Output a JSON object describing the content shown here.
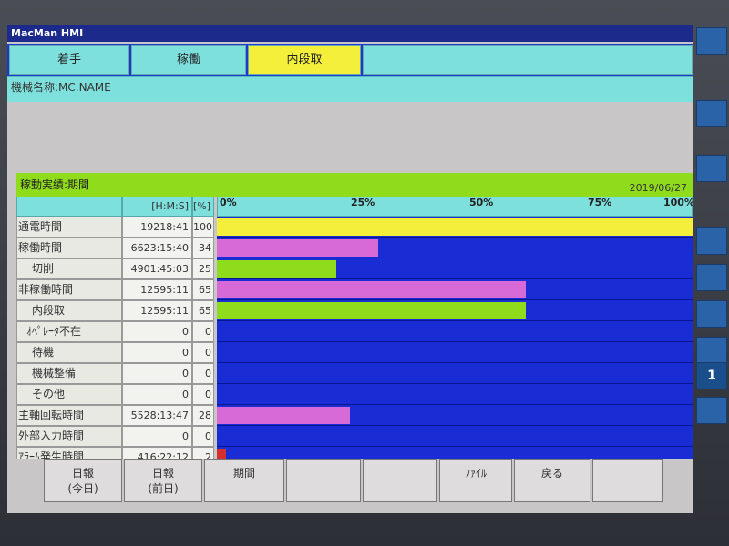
{
  "window": {
    "title": "MacMan HMI"
  },
  "tabs": [
    {
      "label": "着手",
      "active": false
    },
    {
      "label": "稼働",
      "active": false
    },
    {
      "label": "内段取",
      "active": true
    }
  ],
  "machine": {
    "label": "機械名称:MC.NAME"
  },
  "section": {
    "title": "稼動実績:期間",
    "date": "2019/06/27"
  },
  "columns": {
    "time": "[H:M:S]",
    "pct": "[%]"
  },
  "scale": {
    "p0": "0%",
    "p25": "25%",
    "p50": "50%",
    "p75": "75%",
    "p100": "100%"
  },
  "rows": [
    {
      "name": "通電時間",
      "time": "19218:41",
      "pct": "100",
      "color": "#f3ef3a"
    },
    {
      "name": "稼働時間",
      "time": "6623:15:40",
      "pct": "34",
      "color": "#d86ad8"
    },
    {
      "name": "切削",
      "time": "4901:45:03",
      "pct": "25",
      "color": "#8fdc1d"
    },
    {
      "name": "非稼働時間",
      "time": "12595:11",
      "pct": "65",
      "color": "#d86ad8"
    },
    {
      "name": "内段取",
      "time": "12595:11",
      "pct": "65",
      "color": "#8fdc1d"
    },
    {
      "name": "ｵﾍﾟﾚｰﾀ不在",
      "time": "0",
      "pct": "0",
      "color": "#8fdc1d"
    },
    {
      "name": "待機",
      "time": "0",
      "pct": "0",
      "color": "#8fdc1d"
    },
    {
      "name": "機械整備",
      "time": "0",
      "pct": "0",
      "color": "#8fdc1d"
    },
    {
      "name": "その他",
      "time": "0",
      "pct": "0",
      "color": "#8fdc1d"
    },
    {
      "name": "主軸回転時間",
      "time": "5528:13:47",
      "pct": "28",
      "color": "#d86ad8"
    },
    {
      "name": "外部入力時間",
      "time": "0",
      "pct": "0",
      "color": "#d86ad8"
    },
    {
      "name": "ｱﾗｰﾑ発生時間",
      "time": "416:22:12",
      "pct": "2",
      "color": "#d43030"
    }
  ],
  "softkeys": [
    {
      "line1": "日報",
      "line2": "(今日)"
    },
    {
      "line1": "日報",
      "line2": "(前日)"
    },
    {
      "line1": "期間",
      "line2": ""
    },
    {
      "line1": "",
      "line2": ""
    },
    {
      "line1": "",
      "line2": ""
    },
    {
      "line1": "ﾌｧｲﾙ",
      "line2": ""
    },
    {
      "line1": "戻る",
      "line2": ""
    },
    {
      "line1": "",
      "line2": ""
    }
  ],
  "rightbar": {
    "page": "1"
  }
}
